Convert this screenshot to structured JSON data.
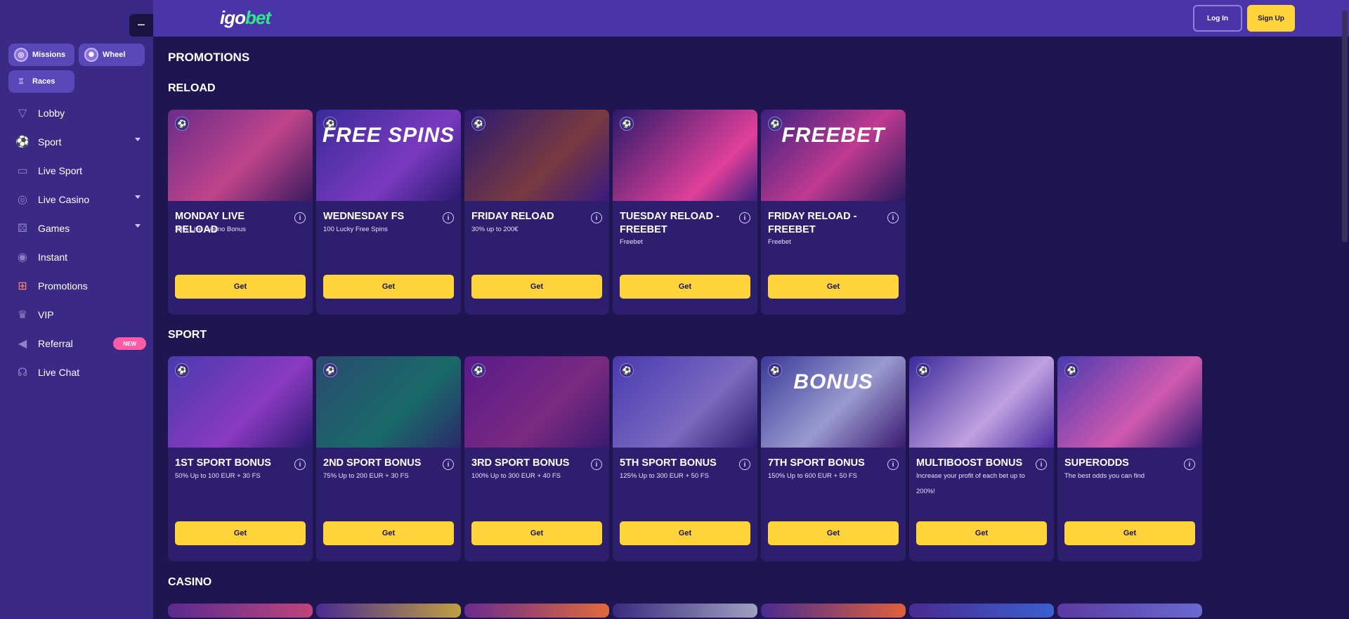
{
  "sidebar": {
    "collapse_label": "−",
    "chips": [
      {
        "label": "Missions",
        "icon": "target-icon"
      },
      {
        "label": "Wheel",
        "icon": "wheel-icon"
      },
      {
        "label": "Races",
        "icon": "trophy-icon"
      }
    ],
    "items": [
      {
        "label": "Lobby",
        "icon": "cocktail-icon",
        "glyph": "🍸"
      },
      {
        "label": "Sport",
        "icon": "soccer-ball-icon",
        "glyph": "⚽"
      },
      {
        "label": "Live Sport",
        "icon": "tv-icon",
        "glyph": "📺"
      },
      {
        "label": "Live Casino",
        "icon": "roulette-icon",
        "glyph": "◎"
      },
      {
        "label": "Games",
        "icon": "dice-icon",
        "glyph": "🎲"
      },
      {
        "label": "Instant",
        "icon": "gauge-icon",
        "glyph": "◉"
      },
      {
        "label": "Promotions",
        "icon": "gift-icon",
        "glyph": "🎁"
      },
      {
        "label": "VIP",
        "icon": "crown-icon",
        "glyph": "♛"
      },
      {
        "label": "Referral",
        "icon": "megaphone-icon",
        "glyph": "📣",
        "badge": "NEW"
      },
      {
        "label": "Live Chat",
        "icon": "headset-icon",
        "glyph": "🎧"
      }
    ]
  },
  "header": {
    "logo": {
      "part1": "igo",
      "part2": "bet"
    },
    "login_label": "Log In",
    "signup_label": "Sign Up"
  },
  "main": {
    "page_title": "PROMOTIONS",
    "sections": [
      {
        "title": "RELOAD",
        "cards": [
          {
            "title": "MONDAY LIVE RELOAD",
            "desc": "25% Live Casino Bonus",
            "button": "Get",
            "art": "",
            "bg": "linear-gradient(135deg,#6a2c8a,#c0448a 55%,#3a1a60)"
          },
          {
            "title": "WEDNESDAY FS",
            "desc": "100 Lucky Free Spins",
            "button": "Get",
            "art": "FREE SPINS",
            "bg": "linear-gradient(135deg,#3a2a9a,#7a3ac0 60%,#2a1a70)"
          },
          {
            "title": "FRIDAY RELOAD",
            "desc": "30% up to 200€",
            "button": "Get",
            "art": "",
            "bg": "linear-gradient(135deg,#2a1a70,#7a3a40 60%,#3a1a80)"
          },
          {
            "title": "TUESDAY RELOAD - FREEBET",
            "desc": "Freebet",
            "button": "Get",
            "art": "",
            "bg": "linear-gradient(135deg,#2a1a6a,#e0409a 70%,#3a2080)"
          },
          {
            "title": "FRIDAY RELOAD - FREEBET",
            "desc": "Freebet",
            "button": "Get",
            "art": "FREEBET",
            "bg": "linear-gradient(135deg,#3a2080,#c03a90 55%,#2a1a60)"
          }
        ]
      },
      {
        "title": "SPORT",
        "cards": [
          {
            "title": "1ST SPORT BONUS",
            "desc": "50% Up to 100 EUR + 30 FS",
            "button": "Get",
            "art": "",
            "bg": "linear-gradient(135deg,#4a3ab0,#8a3ac0 60%,#2a1a70)"
          },
          {
            "title": "2ND SPORT BONUS",
            "desc": "75% Up to 200 EUR + 30 FS",
            "button": "Get",
            "art": "",
            "bg": "linear-gradient(135deg,#2a4a70,#1a6a6a 60%,#2a2a6a)"
          },
          {
            "title": "3RD SPORT BONUS",
            "desc": "100% Up to 300 EUR + 40 FS",
            "button": "Get",
            "art": "",
            "bg": "linear-gradient(135deg,#5a1a8a,#7a2a80 60%,#3a1a70)"
          },
          {
            "title": "5TH SPORT BONUS",
            "desc": "125% Up to 300 EUR + 50 FS",
            "button": "Get",
            "art": "",
            "bg": "linear-gradient(135deg,#4a3ab0,#7a6ac0 60%,#2a1a70)"
          },
          {
            "title": "7TH SPORT BONUS",
            "desc": "150% Up to 600 EUR + 50 FS",
            "button": "Get",
            "art": "BONUS",
            "bg": "linear-gradient(135deg,#3a3a9a,#9a9ad0 55%,#3a1a70)"
          },
          {
            "title": "MULTIBOOST BONUS",
            "desc": "Increase your profit of each bet up to 200%!",
            "button": "Get",
            "art": "",
            "bg": "linear-gradient(135deg,#3a2a9a,#c0a0e0 60%,#4a2aa0)"
          },
          {
            "title": "SUPERODDS",
            "desc": "The best odds you can find",
            "button": "Get",
            "art": "",
            "bg": "linear-gradient(135deg,#4a3ab0,#d05ab0 60%,#2a1a70)"
          }
        ]
      }
    ],
    "casino_title": "CASINO",
    "casino_previews": [
      {
        "bg": "linear-gradient(90deg,#5a2a90,#c0447a)"
      },
      {
        "bg": "linear-gradient(90deg,#4a2a90,#c0a040)"
      },
      {
        "bg": "linear-gradient(90deg,#6a2a90,#e06a3a)"
      },
      {
        "bg": "linear-gradient(90deg,#3a2a80,#a0a0c0)"
      },
      {
        "bg": "linear-gradient(90deg,#4a2a90,#e0603a)"
      },
      {
        "bg": "linear-gradient(90deg,#4a2a90,#3a60d0)"
      },
      {
        "bg": "linear-gradient(90deg,#5a3aa0,#6a6ad0)"
      }
    ]
  }
}
